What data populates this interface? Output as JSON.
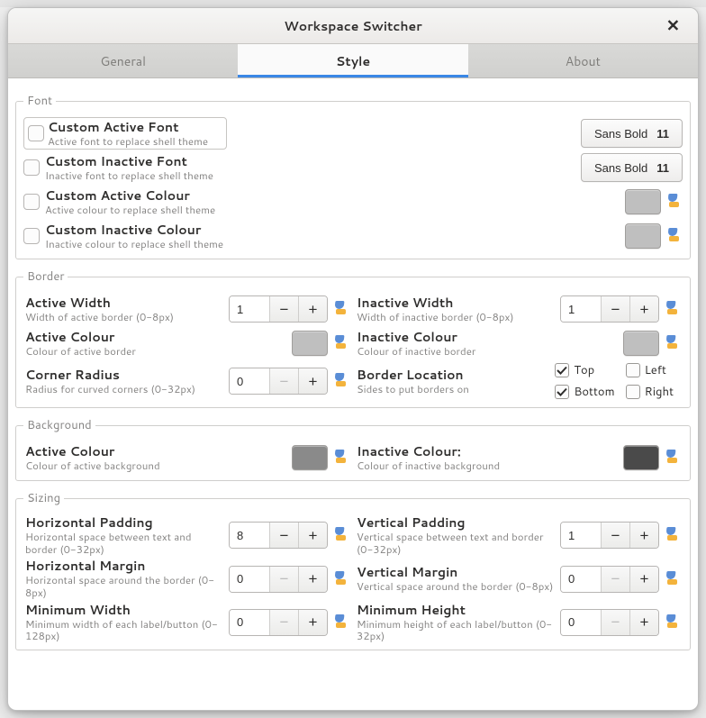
{
  "window": {
    "title": "Workspace Switcher"
  },
  "tabs": {
    "general": "General",
    "style": "Style",
    "about": "About",
    "active": "style"
  },
  "groups": {
    "font": {
      "legend": "Font",
      "items": [
        {
          "title": "Custom Active Font",
          "sub": "Active font to replace shell theme",
          "font_name": "Sans Bold",
          "font_size": "11"
        },
        {
          "title": "Custom Inactive Font",
          "sub": "Inactive font to replace shell theme",
          "font_name": "Sans Bold",
          "font_size": "11"
        },
        {
          "title": "Custom Active Colour",
          "sub": "Active colour to replace shell theme"
        },
        {
          "title": "Custom Inactive Colour",
          "sub": "Inactive colour to replace shell theme"
        }
      ]
    },
    "border": {
      "legend": "Border",
      "active_width": {
        "title": "Active Width",
        "sub": "Width of active border (0-8px)",
        "value": "1"
      },
      "inactive_width": {
        "title": "Inactive Width",
        "sub": "Width of inactive border (0-8px)",
        "value": "1"
      },
      "active_colour": {
        "title": "Active Colour",
        "sub": "Colour of active border"
      },
      "inactive_colour": {
        "title": "Inactive Colour",
        "sub": "Colour of inactive border"
      },
      "corner_radius": {
        "title": "Corner Radius",
        "sub": "Radius for curved corners (0-32px)",
        "value": "0"
      },
      "location": {
        "title": "Border Location",
        "sub": "Sides to put borders on",
        "top": "Top",
        "left": "Left",
        "bottom": "Bottom",
        "right": "Right"
      }
    },
    "background": {
      "legend": "Background",
      "active": {
        "title": "Active Colour",
        "sub": "Colour of active background"
      },
      "inactive": {
        "title": "Inactive Colour:",
        "sub": "Colour of inactive background"
      }
    },
    "sizing": {
      "legend": "Sizing",
      "hpad": {
        "title": "Horizontal Padding",
        "sub": "Horizontal space between text and border (0-32px)",
        "value": "8"
      },
      "vpad": {
        "title": "Vertical Padding",
        "sub": "Vertical space between text and border (0-32px)",
        "value": "1"
      },
      "hmargin": {
        "title": "Horizontal Margin",
        "sub": "Horizontal space around the border (0-8px)",
        "value": "0"
      },
      "vmargin": {
        "title": "Vertical Margin",
        "sub": "Vertical space around the border (0-8px)",
        "value": "0"
      },
      "minw": {
        "title": "Minimum Width",
        "sub": "Minimum width of each label/button (0-128px)",
        "value": "0"
      },
      "minh": {
        "title": "Minimum Height",
        "sub": "Minimum height of each label/button (0-32px)",
        "value": "0"
      }
    }
  }
}
